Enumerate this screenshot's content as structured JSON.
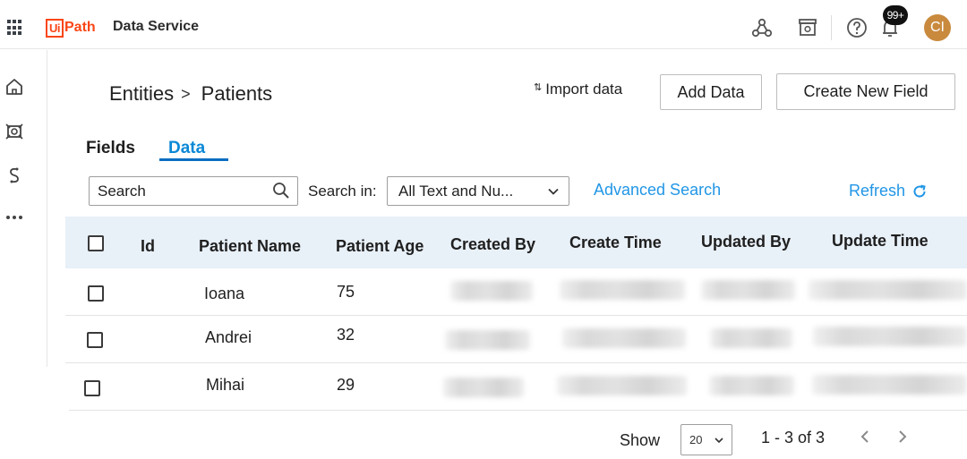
{
  "header": {
    "logo_box": "Ui",
    "logo_rest": "Path",
    "app_name": "Data Service",
    "notification_badge": "99+",
    "avatar_initials": "CI",
    "brand_color": "#fa4616",
    "icons": [
      "apps-grid-icon",
      "webhook-icon",
      "store-icon",
      "help-icon",
      "bell-icon"
    ]
  },
  "sidebar": {
    "icons": [
      "home-icon",
      "entities-icon",
      "choice-sets-icon",
      "more-icon"
    ]
  },
  "breadcrumb": {
    "parent": "Entities",
    "separator": ">",
    "current": "Patients"
  },
  "actions": {
    "import_label": "Import data",
    "add_data_label": "Add Data",
    "create_field_label": "Create New Field"
  },
  "tabs": [
    {
      "label": "Fields",
      "active": false
    },
    {
      "label": "Data",
      "active": true
    }
  ],
  "filter": {
    "search_placeholder": "Search",
    "search_in_label": "Search in:",
    "search_in_value": "All Text and Nu...",
    "advanced_search_label": "Advanced Search",
    "refresh_label": "Refresh",
    "link_color": "#2196e6"
  },
  "table": {
    "columns": [
      "Id",
      "Patient Name",
      "Patient Age",
      "Created By",
      "Create Time",
      "Updated By",
      "Update Time"
    ],
    "rows": [
      {
        "id": "",
        "name": "Ioana",
        "age": "75"
      },
      {
        "id": "",
        "name": "Andrei",
        "age": "32"
      },
      {
        "id": "",
        "name": "Mihai",
        "age": "29"
      }
    ],
    "header_bg": "#e8f0f8"
  },
  "pager": {
    "show_label": "Show",
    "page_size": "20",
    "range": "1 - 3 of 3"
  }
}
